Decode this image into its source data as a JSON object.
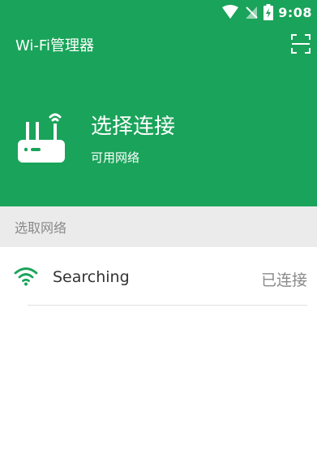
{
  "statusbar": {
    "time": "9:08",
    "icons": [
      "wifi-signal-icon",
      "cell-signal-off-icon",
      "battery-charging-icon"
    ]
  },
  "appbar": {
    "title": "Wi-Fi管理器",
    "action_icon": "scan-icon"
  },
  "hero": {
    "icon": "router-icon",
    "title": "选择连接",
    "subtitle": "可用网络"
  },
  "section": {
    "label": "选取网络"
  },
  "networks": [
    {
      "icon": "wifi-icon",
      "ssid": "Searching",
      "status": "已连接"
    }
  ],
  "colors": {
    "primary": "#1aa35a",
    "section_bg": "#ebebeb",
    "muted_text": "#8a8a8a"
  }
}
